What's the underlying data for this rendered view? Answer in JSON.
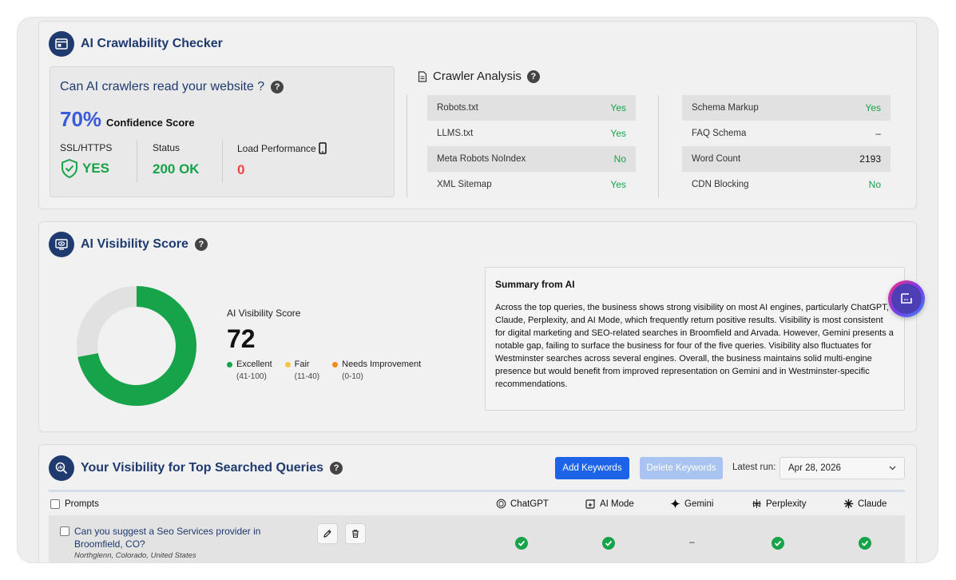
{
  "crawlability": {
    "title": "AI Crawlability Checker",
    "question": "Can AI crawlers read your website ?",
    "confidence_pct": "70%",
    "confidence_label": "Confidence Score",
    "ssl_label": "SSL/HTTPS",
    "ssl_value": "YES",
    "status_label": "Status",
    "status_value": "200 OK",
    "load_label": "Load Performance",
    "load_value": "0"
  },
  "crawler_analysis": {
    "title": "Crawler Analysis",
    "left": [
      {
        "label": "Robots.txt",
        "value": "Yes"
      },
      {
        "label": "LLMS.txt",
        "value": "Yes"
      },
      {
        "label": "Meta Robots NoIndex",
        "value": "No"
      },
      {
        "label": "XML Sitemap",
        "value": "Yes"
      }
    ],
    "right": [
      {
        "label": "Schema Markup",
        "value": "Yes"
      },
      {
        "label": "FAQ Schema",
        "value": "–"
      },
      {
        "label": "Word Count",
        "value": "2193"
      },
      {
        "label": "CDN Blocking",
        "value": "No"
      }
    ]
  },
  "visibility": {
    "title": "AI Visibility Score",
    "score_label": "AI Visibility Score",
    "score": 72,
    "legend": [
      {
        "label": "Excellent",
        "range": "(41-100)",
        "color": "#16a34a"
      },
      {
        "label": "Fair",
        "range": "(11-40)",
        "color": "#f5c542"
      },
      {
        "label": "Needs Improvement",
        "range": "(0-10)",
        "color": "#f08c1a"
      }
    ],
    "summary_title": "Summary from AI",
    "summary_text": "Across the top queries, the business shows strong visibility on most AI engines, particularly ChatGPT, Claude, Perplexity, and AI Mode, which frequently return positive results. Visibility is most consistent for digital marketing and SEO-related searches in Broomfield and Arvada. However, Gemini presents a notable gap, failing to surface the business for four of the five queries. Visibility also fluctuates for Westminster searches across several engines. Overall, the business maintains solid multi-engine presence but would benefit from improved representation on Gemini and in Westminster-specific recommendations."
  },
  "queries": {
    "title": "Your Visibility for Top Searched Queries",
    "add_button": "Add Keywords",
    "delete_button": "Delete Keywords",
    "latest_run_label": "Latest run:",
    "latest_run_value": "Apr 28, 2026",
    "prompts_header": "Prompts",
    "engines": [
      "ChatGPT",
      "AI Mode",
      "Gemini",
      "Perplexity",
      "Claude"
    ],
    "rows": [
      {
        "prompt": "Can you suggest a Seo Services provider in Broomfield, CO?",
        "location": "Northglenn, Colorado, United States",
        "results": [
          "check",
          "check",
          "–",
          "check",
          "check"
        ]
      }
    ]
  }
}
